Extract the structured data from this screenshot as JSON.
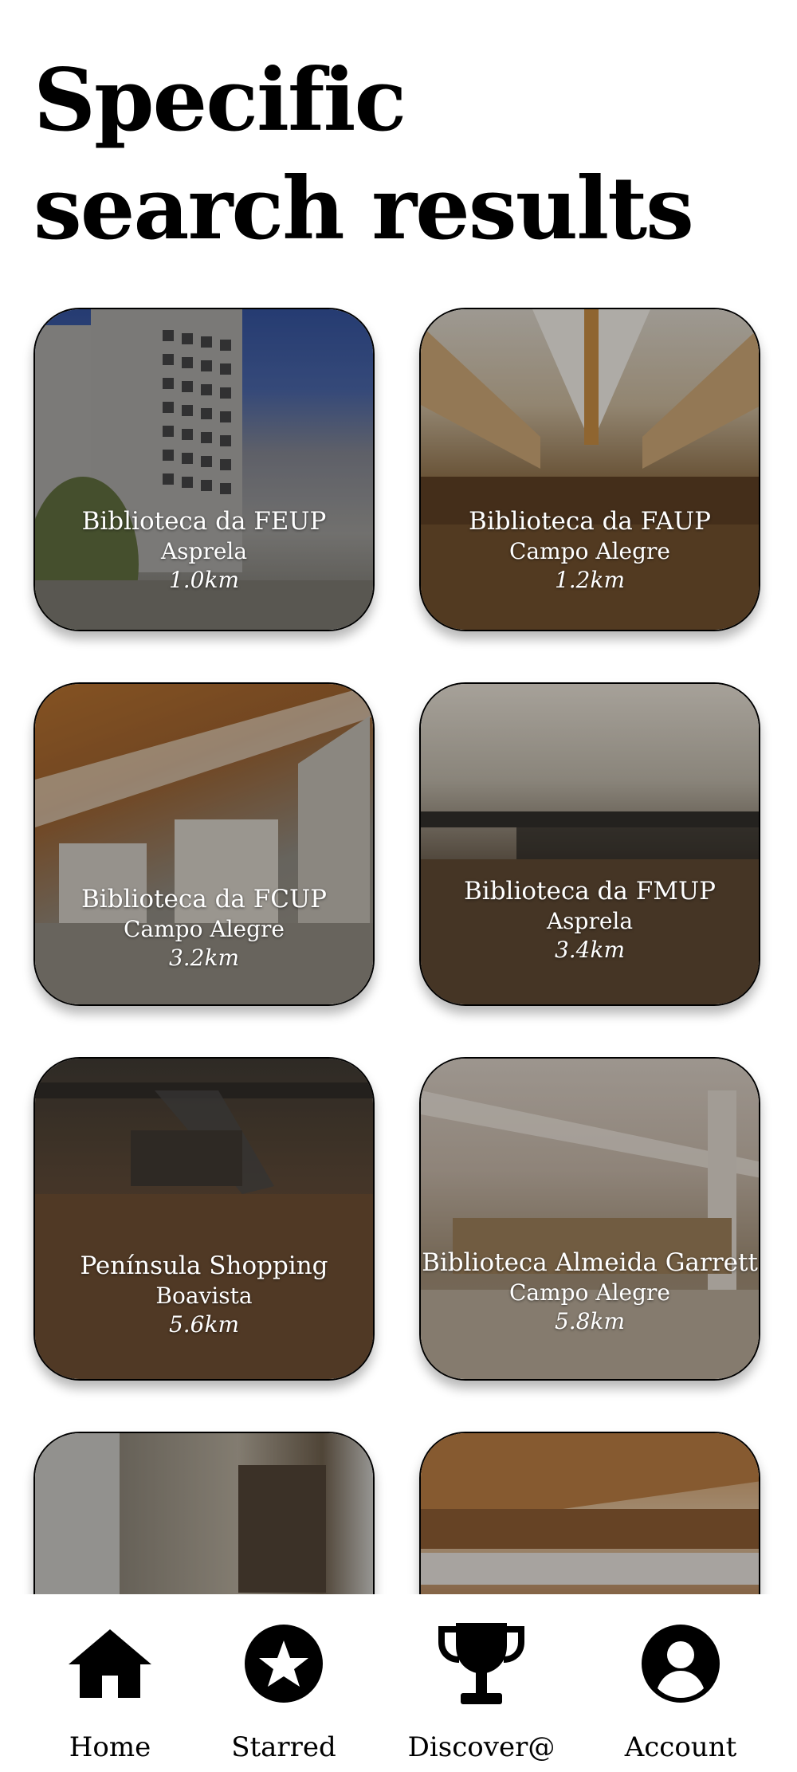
{
  "page": {
    "title_line1": "Specific",
    "title_line2": "search results"
  },
  "results": [
    {
      "name": "Biblioteca da FEUP",
      "area": "Asprela",
      "distance": "1.0km",
      "photo": "building-exterior"
    },
    {
      "name": "Biblioteca da FAUP",
      "area": "Campo Alegre",
      "distance": "1.2km",
      "photo": "library-interior"
    },
    {
      "name": "Biblioteca da FCUP",
      "area": "Campo Alegre",
      "distance": "3.2km",
      "photo": "exhibition-hall"
    },
    {
      "name": "Biblioteca da FMUP",
      "area": "Asprela",
      "distance": "3.4km",
      "photo": "reading-room"
    },
    {
      "name": "Península Shopping",
      "area": "Boavista",
      "distance": "5.6km",
      "photo": "shopping-mall"
    },
    {
      "name": "Biblioteca Almeida Garrett",
      "area": "Campo Alegre",
      "distance": "5.8km",
      "photo": "library-shelves"
    },
    {
      "name": "",
      "area": "",
      "distance": "",
      "photo": "hallway"
    },
    {
      "name": "",
      "area": "",
      "distance": "",
      "photo": "library-atrium"
    }
  ],
  "nav": {
    "home": {
      "label": "Home",
      "icon": "home-icon"
    },
    "starred": {
      "label": "Starred",
      "icon": "star-icon"
    },
    "discover": {
      "label": "Discover@",
      "icon": "trophy-icon"
    },
    "account": {
      "label": "Account",
      "icon": "account-icon"
    }
  },
  "colors": {
    "text": "#000000",
    "background": "#ffffff",
    "card_text": "#ffffff"
  }
}
